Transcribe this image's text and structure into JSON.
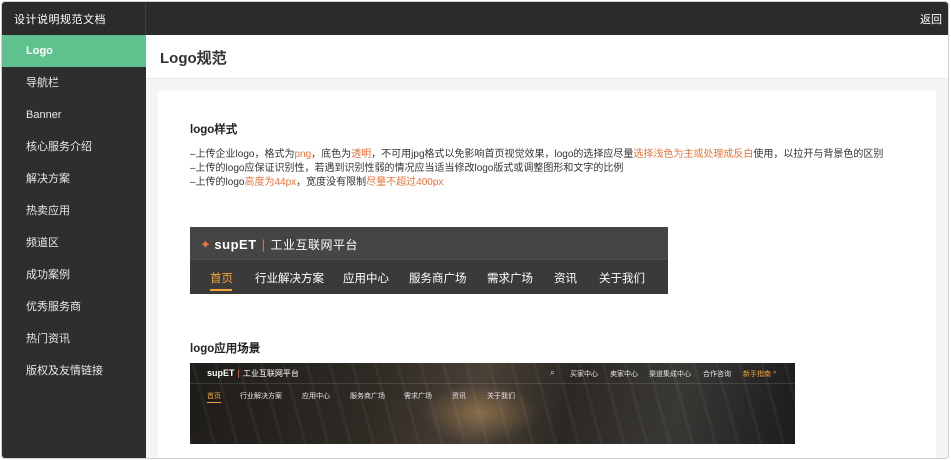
{
  "topbar": {
    "app_title": "设计说明规范文档",
    "back_label": "返回"
  },
  "sidebar": {
    "items": [
      {
        "label": "Logo",
        "active": true
      },
      {
        "label": "导航栏"
      },
      {
        "label": "Banner"
      },
      {
        "label": "核心服务介绍"
      },
      {
        "label": "解决方案"
      },
      {
        "label": "热卖应用"
      },
      {
        "label": "频道区"
      },
      {
        "label": "成功案例"
      },
      {
        "label": "优秀服务商"
      },
      {
        "label": "热门资讯"
      },
      {
        "label": "版权及友情链接"
      }
    ]
  },
  "page": {
    "title": "Logo规范"
  },
  "logo_style": {
    "title": "logo样式",
    "rules": [
      {
        "a": "–上传企业logo，格式为",
        "b": "png",
        "c": "，底色为",
        "d": "透明",
        "e": "，不可用jpg格式以免影响首页视觉效果，logo的选择应尽量",
        "f": "选择浅色为主或处理成反白",
        "g": "使用，以拉开与背景色的区别"
      },
      {
        "a": "–上传的logo应保证识别性，若遇到识别性弱的情况应当适当修改logo版式或调整图形和文字的比例"
      },
      {
        "a": "–上传的logo",
        "b": "高度为44px",
        "c": "，宽度没有限制",
        "d": "尽量不超过400px"
      }
    ]
  },
  "logo_preview": {
    "brand": "supET",
    "slogan": "工业互联网平台",
    "menu": [
      "首页",
      "行业解决方案",
      "应用中心",
      "服务商广场",
      "需求广场",
      "资讯",
      "关于我们"
    ]
  },
  "logo_scene": {
    "title": "logo应用场景",
    "brand": "supET",
    "slogan": "工业互联网平台",
    "top_links": [
      "买家中心",
      "卖家中心",
      "渠道集成中心",
      "合作咨询",
      "新手指南"
    ],
    "search_icon": "search-icon",
    "menu": [
      "首页",
      "行业解决方案",
      "应用中心",
      "服务商广场",
      "需求广场",
      "资讯",
      "关于我们"
    ]
  },
  "colors": {
    "accent_green": "#5ec18e",
    "highlight_orange": "#e8743b",
    "menu_active": "#f2a53a"
  }
}
